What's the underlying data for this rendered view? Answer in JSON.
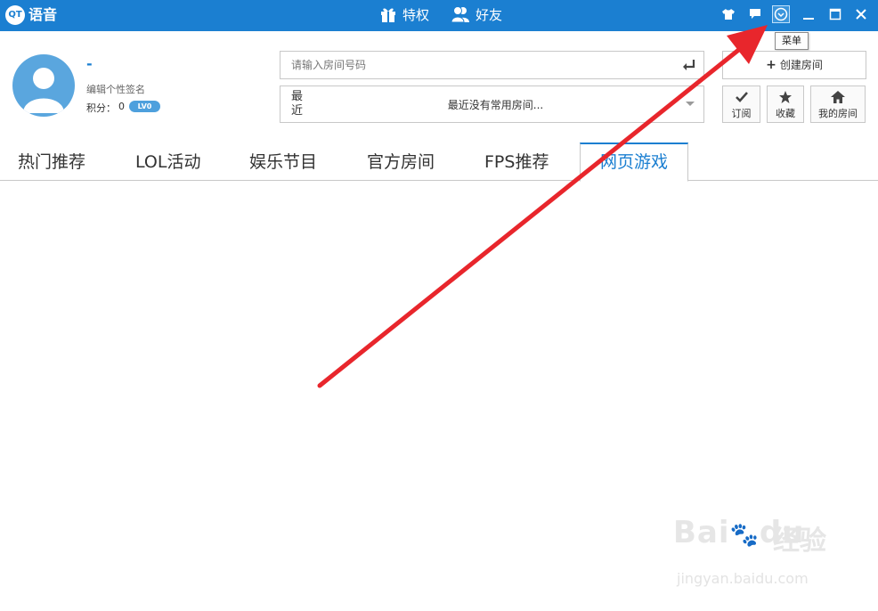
{
  "titlebar": {
    "logo_text": "QT",
    "app_title": "语音",
    "nav": [
      {
        "label": "特权",
        "icon": "gift-icon"
      },
      {
        "label": "好友",
        "icon": "friends-icon"
      }
    ],
    "window_icons": [
      "skin-icon",
      "message-icon",
      "menu-icon",
      "minimize-icon",
      "maximize-icon",
      "close-icon"
    ],
    "accent": "#1b7fd1"
  },
  "tooltip": {
    "text": "菜单"
  },
  "profile": {
    "username": "-",
    "signature": "编辑个性签名",
    "points_label": "积分：",
    "points_value": "0",
    "level": "LV0"
  },
  "room": {
    "placeholder": "请输入房间号码",
    "recent_label": "最近",
    "recent_text": "最近没有常用房间..."
  },
  "actions": {
    "create_room": "创建房间",
    "subscribe": "订阅",
    "favorite": "收藏",
    "my_room": "我的房间"
  },
  "tabs": [
    {
      "label": "热门推荐",
      "active": false
    },
    {
      "label": "LOL活动",
      "active": false
    },
    {
      "label": "娱乐节目",
      "active": false
    },
    {
      "label": "官方房间",
      "active": false
    },
    {
      "label": "FPS推荐",
      "active": false
    },
    {
      "label": "网页游戏",
      "active": true
    }
  ],
  "watermark": {
    "brand": "Bai",
    "brand2": "du",
    "product": "经验",
    "url": "jingyan.baidu.com"
  },
  "annotation_color": "#e8262c"
}
